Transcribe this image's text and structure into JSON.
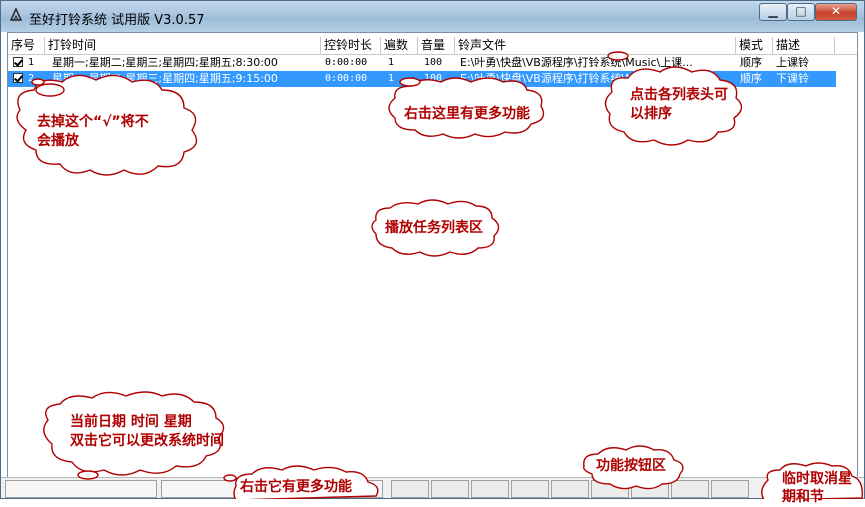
{
  "window": {
    "title": "至好打铃系统 试用版 V3.0.57"
  },
  "columns": [
    "序号",
    "打铃时间",
    "控铃时长",
    "遍数",
    "音量",
    "铃声文件",
    "模式",
    "描述"
  ],
  "rows": [
    {
      "num": "1",
      "time": "星期一;星期二;星期三;星期四;星期五;8:30:00",
      "duration": "0:00:00",
      "repeat": "1",
      "volume": "100",
      "file": "E:\\叶勇\\快盘\\VB源程序\\打铃系统\\Music\\上课...",
      "mode": "顺序",
      "desc": "上课铃",
      "checked": true,
      "selected": false
    },
    {
      "num": "2",
      "time": "星期一;星期二;星期三;星期四;星期五;9:15:00",
      "duration": "0:00:00",
      "repeat": "1",
      "volume": "100",
      "file": "E:\\叶勇\\快盘\\VB源程序\\打铃系统\\Music\\下课...",
      "mode": "顺序",
      "desc": "下课铃",
      "checked": true,
      "selected": true
    }
  ],
  "callouts": {
    "uncheck": {
      "line1": "去掉这个“√”将不",
      "line2": "会播放"
    },
    "rightclick": "右击这里有更多功能",
    "sort": {
      "line1": "点击各列表头可",
      "line2": "以排序"
    },
    "tasklist": "播放任务列表区",
    "datetime": {
      "line1": "当前日期  时间  星期",
      "line2": "双击它可以更改系统时间"
    },
    "status_rightclick": "右击它有更多功能",
    "buttons": "功能按钮区",
    "cancel": {
      "line1": "临时取消星",
      "line2": "期和节"
    }
  },
  "colors": {
    "selection": "#3399ff",
    "annotation": "#b00000"
  }
}
